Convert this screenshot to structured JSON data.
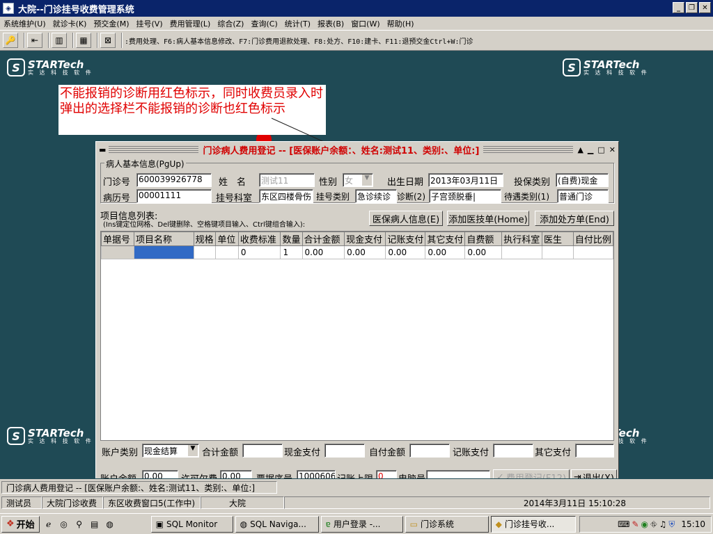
{
  "window": {
    "title": "大院--门诊挂号收费管理系统",
    "app_icon": "app-icon"
  },
  "menu": [
    "系统维护(U)",
    "就诊卡(K)",
    "预交金(M)",
    "挂号(V)",
    "费用管理(L)",
    "综合(Z)",
    "查询(C)",
    "统计(T)",
    "报表(B)",
    "窗口(W)",
    "帮助(H)"
  ],
  "toolbar": {
    "hint": ":费用处理、F6:病人基本信息修改、F7:门诊费用退款处理、F8:处方、F10:建卡、F11:退预交金Ctrl+W:门诊"
  },
  "logo": {
    "brand": "STARTech",
    "sub": "实 达 科 技 软 件"
  },
  "annotation": "不能报销的诊断用红色标示，同时收费员录入时弹出的选择栏不能报销的诊断也红色标示",
  "dialog": {
    "title": "门诊病人费用登记 -- [医保账户余额：、姓名:测试11、类别:、单位:]",
    "group_label": "病人基本信息(PgUp)",
    "fields": {
      "clinic_no_label": "门诊号",
      "clinic_no": "600039926778",
      "name_label": "姓　名",
      "name": "测试11",
      "sex_label": "性别",
      "sex": "女",
      "birth_label": "出生日期",
      "birth": "2013年03月11日",
      "insure_type_label": "投保类别",
      "insure_type": "(自费)现金",
      "record_no_label": "病历号",
      "record_no": "00001111",
      "dept_label": "挂号科室",
      "dept": "东区四楼骨伤",
      "reg_type_label": "挂号类别",
      "reg_type": "急诊续诊",
      "diagnosis_label": "诊断(2)",
      "diagnosis": "子宫颈脱垂|",
      "treat_type_label": "待遇类别(1)",
      "treat_type": "普通门诊"
    },
    "items_label": "项目信息列表:",
    "items_hint": "(Ins键定位网格、Del键删除、空格键项目输入、Ctrl键组合输入):",
    "buttons": {
      "insurance_info": "医保病人信息(E)",
      "add_tech": "添加医技单(Home)",
      "add_prescription": "添加处方单(End)",
      "register": "费用登记(F12)",
      "exit": "退出(X)"
    },
    "grid": {
      "columns": [
        "单据号",
        "项目名称",
        "规格",
        "单位",
        "收费标准",
        "数量",
        "合计金额",
        "现金支付",
        "记账支付",
        "其它支付",
        "自费额",
        "执行科室",
        "医生",
        "自付比例"
      ],
      "rows": [
        [
          "",
          "",
          "",
          "",
          "0",
          "1",
          "0.00",
          "0.00",
          "0.00",
          "0.00",
          "0.00",
          "",
          "",
          ""
        ]
      ]
    },
    "footer": {
      "account_type_label": "账户类别",
      "account_type": "现金结算",
      "total_label": "合计金额",
      "cash_label": "现金支付",
      "self_label": "自付金额",
      "charge_label": "记账支付",
      "other_label": "其它支付",
      "balance_label": "账户余额",
      "balance": "0.00",
      "overdraft_label": "许可欠费",
      "overdraft": "0.00",
      "invoice_label": "票据序号",
      "invoice": "1000606",
      "limit_label": "记账上限",
      "limit": "0",
      "pc_label": "电脑号"
    }
  },
  "status": {
    "line1": "门诊病人费用登记 -- [医保账户余额:、姓名:测试11、类别:、单位:]",
    "operator": "测试员",
    "station": "大院门诊收费",
    "window": "东区收费窗口5(工作中)",
    "hospital": "大院",
    "datetime": "2014年3月11日  15:10:28"
  },
  "taskbar": {
    "start": "开始",
    "tasks": [
      "SQL Monitor",
      "SQL Naviga...",
      "用户登录 -...",
      "门诊系统",
      "门诊挂号收..."
    ],
    "clock": "15:10"
  }
}
